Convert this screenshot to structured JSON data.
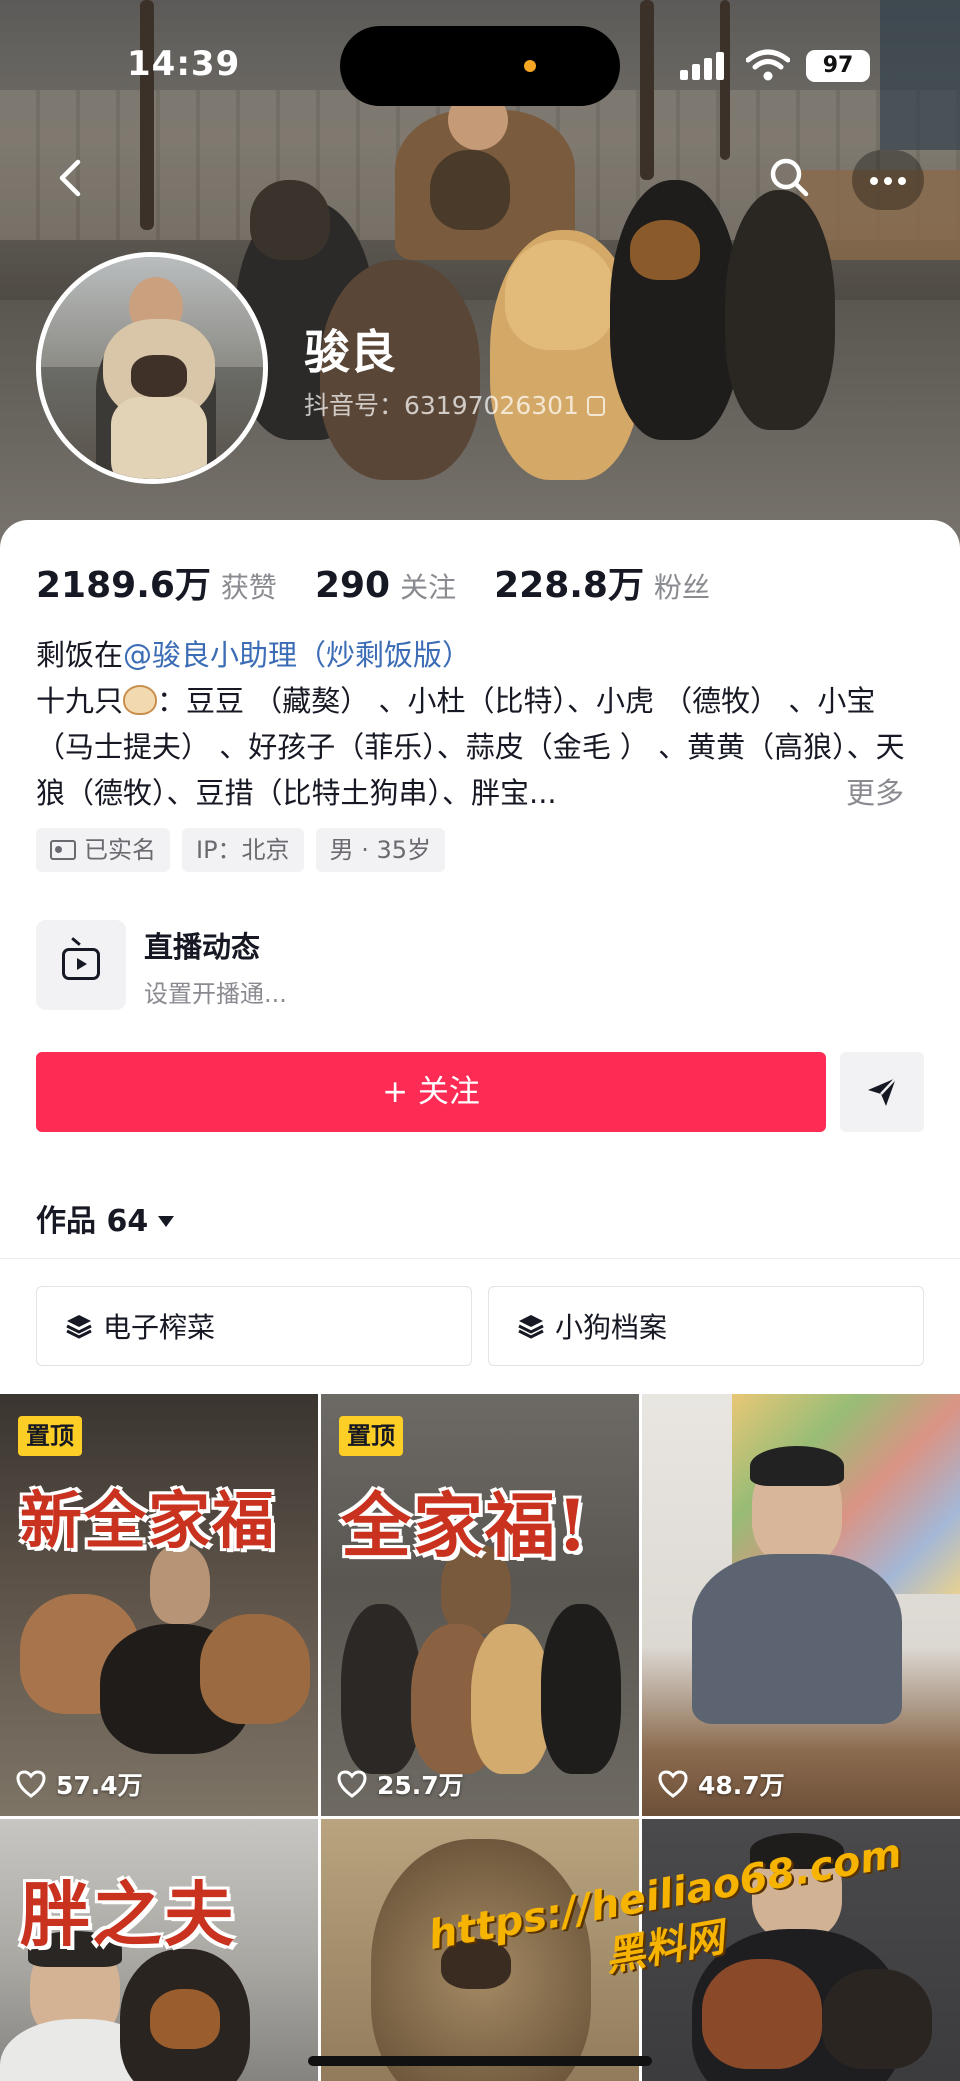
{
  "status_bar": {
    "time": "14:39",
    "battery": "97"
  },
  "profile": {
    "name": "骏良",
    "douyin_id": "抖音号：63197026301",
    "stats": [
      {
        "value": "2189.6万",
        "label": "获赞"
      },
      {
        "value": "290",
        "label": "关注"
      },
      {
        "value": "228.8万",
        "label": "粉丝"
      }
    ],
    "bio_prefix": "剩饭在",
    "bio_mention": "@骏良小助理（炒剩饭版）",
    "bio_dogs_intro": "十九只",
    "bio_dogs": "：豆豆 （藏獒） 、小杜（比特）、小虎 （德牧） 、小宝（马士提夫） 、好孩子（菲乐）、蒜皮（金毛 ） 、黄黄（高狼）、天狼（德牧）、豆措（比特土狗串）、胖宝...",
    "bio_more": "更多",
    "tags": [
      "已实名",
      "IP：北京",
      "男 · 35岁"
    ]
  },
  "live": {
    "title": "直播动态",
    "subtitle": "设置开播通..."
  },
  "actions": {
    "follow_label": "+ 关注"
  },
  "works": {
    "label": "作品 64"
  },
  "collections": [
    "电子榨菜",
    "小狗档案"
  ],
  "videos": [
    {
      "pinned": "置顶",
      "overlay": "新全家福",
      "likes": "57.4万"
    },
    {
      "pinned": "置顶",
      "overlay": "全家福!",
      "likes": "25.7万"
    },
    {
      "pinned": "",
      "overlay": "",
      "likes": "48.7万"
    },
    {
      "pinned": "",
      "overlay": "胖之夫",
      "likes": ""
    },
    {
      "pinned": "",
      "overlay": "",
      "likes": ""
    },
    {
      "pinned": "",
      "overlay": "",
      "likes": ""
    }
  ],
  "watermark": {
    "url": "https://heiliao68.com",
    "name": "黑料网"
  },
  "colors": {
    "accent": "#fe2c55",
    "mention": "#3b6cb5",
    "pin": "#fdce25",
    "overlay_text": "#c8321f"
  },
  "icons": [
    "back-icon",
    "search-icon",
    "more-icon",
    "copy-icon",
    "id-card-icon",
    "tv-icon",
    "share-icon",
    "stack-icon",
    "heart-icon"
  ]
}
